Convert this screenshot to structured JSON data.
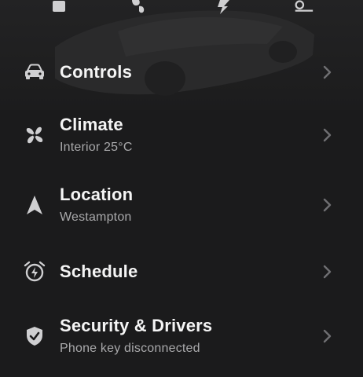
{
  "theme": {
    "background": "#1b1b1c",
    "text": "#f5f5f5",
    "subtext": "#a9a9ab",
    "icon": "#cfcfd1",
    "chevron": "#6f6f72"
  },
  "top_icons": [
    {
      "icon": "lock-icon"
    },
    {
      "icon": "fan-icon"
    },
    {
      "icon": "charging-bolt-icon"
    },
    {
      "icon": "trunk-icon"
    }
  ],
  "menu": {
    "items": [
      {
        "title": "Controls",
        "subtitle": "",
        "icon": "car-icon"
      },
      {
        "title": "Climate",
        "subtitle": "Interior 25°C",
        "icon": "fan-icon"
      },
      {
        "title": "Location",
        "subtitle": "Westampton",
        "icon": "navigation-arrow-icon"
      },
      {
        "title": "Schedule",
        "subtitle": "",
        "icon": "alarm-clock-bolt-icon"
      },
      {
        "title": "Security & Drivers",
        "subtitle": "Phone key disconnected",
        "icon": "shield-check-icon"
      }
    ]
  }
}
